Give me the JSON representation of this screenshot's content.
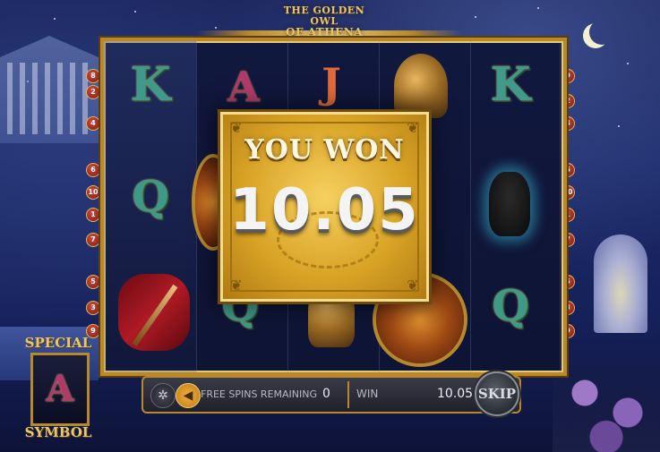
{
  "game": {
    "title_line1": "THE GOLDEN OWL",
    "title_line2": "OF ATHENA"
  },
  "paylines": {
    "left": [
      "8",
      "2",
      "4",
      "6",
      "10",
      "1",
      "7",
      "5",
      "3",
      "9"
    ],
    "right": [
      "9",
      "2",
      "4",
      "6",
      "10",
      "1",
      "7",
      "5",
      "3",
      "9"
    ]
  },
  "reels": {
    "symbols": [
      "K",
      "A",
      "J",
      "helmet",
      "K",
      "Q",
      "shield",
      "vase",
      "spear",
      "Q",
      "helmet",
      "Q"
    ]
  },
  "win_popup": {
    "heading": "YOU WON",
    "amount": "10.05"
  },
  "special_symbol": {
    "top_label": "SPECIAL",
    "letter": "A",
    "bottom_label": "SYMBOL"
  },
  "controls": {
    "settings_icon": "gear-icon",
    "sound_icon": "speaker-icon",
    "free_spins_label": "FREE SPINS REMAINING",
    "free_spins_value": "0",
    "win_label": "WIN",
    "win_value": "10.05",
    "skip_label": "SKIP"
  },
  "colors": {
    "gold": "#b8892c",
    "popup": "#d9a426",
    "background": "#1b2a6a"
  }
}
